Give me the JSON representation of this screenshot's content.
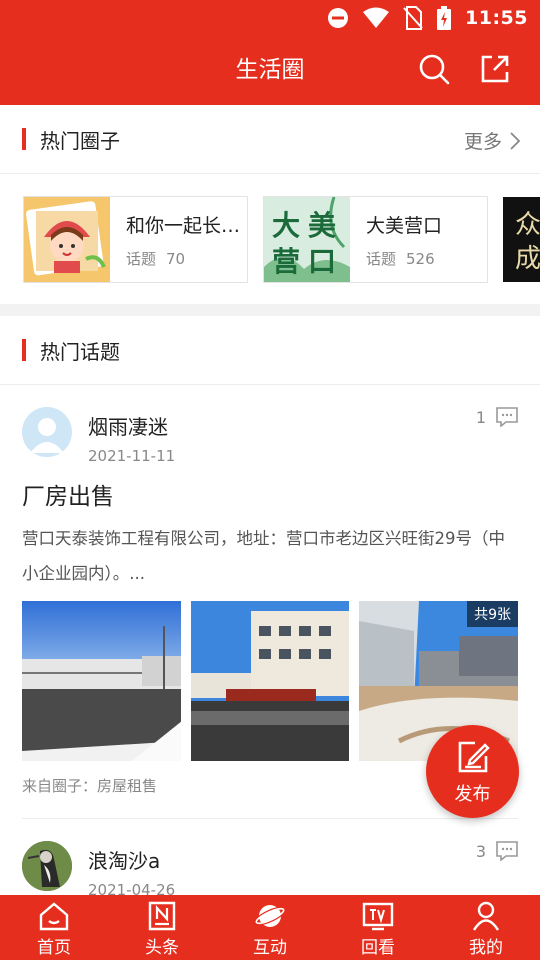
{
  "status_bar": {
    "time": "11:55"
  },
  "header": {
    "title": "生活圈"
  },
  "hot_circles": {
    "title": "热门圈子",
    "more_label": "更多",
    "topics_label": "话题",
    "cards": [
      {
        "name": "和你一起长…",
        "topics": "70"
      },
      {
        "name": "大美营口",
        "topics": "526",
        "thumb_text": [
          "大",
          "美",
          "营",
          "口"
        ]
      },
      {
        "name": "",
        "thumb_text": [
          "众",
          "成"
        ]
      }
    ]
  },
  "hot_topics": {
    "title": "热门话题",
    "posts": [
      {
        "user": "烟雨凄迷",
        "date": "2021-11-11",
        "comments": "1",
        "title": "厂房出售",
        "body": "营口天泰装饰工程有限公司，地址：营口市老边区兴旺街29号（中小企业园内）。...",
        "photo_count_label": "共9张",
        "from": "来自圈子：房屋租售"
      },
      {
        "user": "浪淘沙a",
        "date": "2021-04-26",
        "comments": "3"
      }
    ]
  },
  "fab": {
    "label": "发布"
  },
  "bottom_nav": [
    {
      "label": "首页",
      "icon": "home-icon"
    },
    {
      "label": "头条",
      "icon": "news-icon"
    },
    {
      "label": "互动",
      "icon": "planet-icon"
    },
    {
      "label": "回看",
      "icon": "tv-icon"
    },
    {
      "label": "我的",
      "icon": "user-icon"
    }
  ],
  "colors": {
    "brand": "#e62e1f"
  }
}
